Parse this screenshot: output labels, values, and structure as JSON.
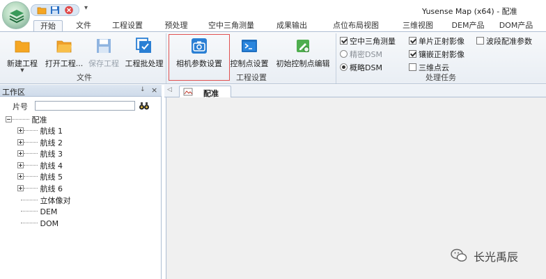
{
  "window": {
    "title": "Yusense Map (x64) - 配准"
  },
  "tabs": [
    {
      "label": "开始",
      "active": true
    },
    {
      "label": "文件"
    },
    {
      "label": "工程设置"
    },
    {
      "label": "预处理"
    },
    {
      "label": "空中三角测量"
    },
    {
      "label": "成果输出"
    },
    {
      "label": "点位布局视图"
    },
    {
      "label": "三维视图"
    },
    {
      "label": "DEM产品"
    },
    {
      "label": "DOM产品"
    }
  ],
  "ribbon": {
    "file_group": {
      "label": "文件",
      "buttons": [
        {
          "label": "新建工程",
          "icon": "folder-new-icon"
        },
        {
          "label": "打开工程...",
          "icon": "folder-open-icon"
        },
        {
          "label": "保存工程",
          "icon": "save-icon",
          "disabled": true
        },
        {
          "label": "工程批处理",
          "icon": "batch-icon"
        }
      ]
    },
    "project_group": {
      "label": "工程设置",
      "buttons": [
        {
          "label": "相机参数设置",
          "icon": "camera-icon",
          "highlighted": true
        },
        {
          "label": "控制点设置",
          "icon": "console-icon"
        },
        {
          "label": "初始控制点编辑",
          "icon": "edit-point-icon"
        }
      ]
    },
    "tasks_group": {
      "label": "处理任务",
      "options": [
        {
          "label": "空中三角测量",
          "type": "checkbox",
          "checked": true
        },
        {
          "label": "单片正射影像",
          "type": "checkbox",
          "checked": true
        },
        {
          "label": "波段配准参数",
          "type": "checkbox",
          "checked": false
        },
        {
          "label": "精密DSM",
          "type": "radio",
          "checked": false,
          "disabled": true
        },
        {
          "label": "镶嵌正射影像",
          "type": "checkbox",
          "checked": true
        },
        {
          "label": "概略DSM",
          "type": "radio",
          "checked": true
        },
        {
          "label": "三维点云",
          "type": "checkbox",
          "checked": false
        }
      ]
    }
  },
  "workspace": {
    "title": "工作区",
    "pin": "↓",
    "close": "×",
    "search_label": "片号",
    "search_value": "",
    "tree": {
      "root": "配准",
      "strips": [
        "航线 1",
        "航线 2",
        "航线 3",
        "航线 4",
        "航线 5",
        "航线 6"
      ],
      "leaves": [
        "立体像对",
        "DEM",
        "DOM"
      ]
    }
  },
  "document": {
    "nav": "◁",
    "tab_label": "配准"
  },
  "watermark": {
    "text": "长光禹辰"
  },
  "colors": {
    "highlight": "#e05050",
    "accent": "#2a7fd4",
    "folder": "#f5a623"
  }
}
